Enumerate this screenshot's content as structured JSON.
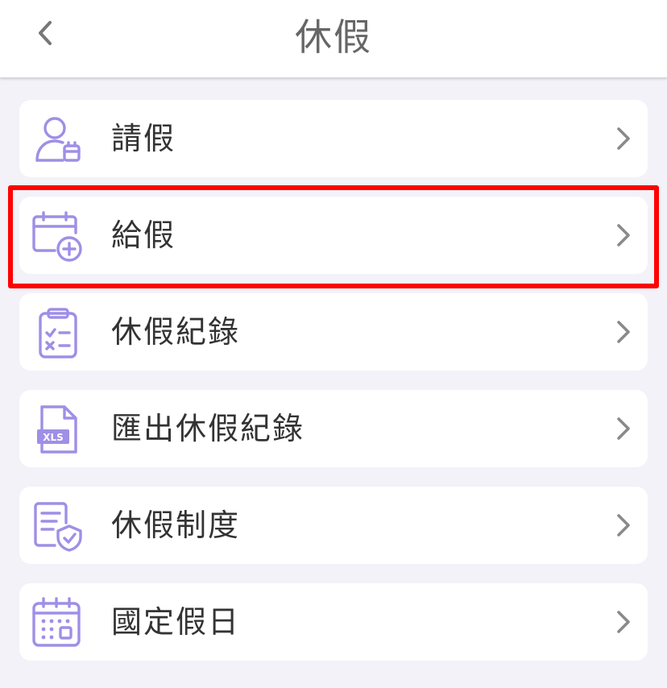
{
  "header": {
    "title": "休假",
    "back_icon": "chevron-left-icon"
  },
  "menu": [
    {
      "label": "請假",
      "icon": "person-calendar-icon"
    },
    {
      "label": "給假",
      "icon": "calendar-plus-icon",
      "highlighted": true
    },
    {
      "label": "休假紀錄",
      "icon": "clipboard-checklist-icon"
    },
    {
      "label": "匯出休假紀錄",
      "icon": "xls-file-icon",
      "icon_text": "XLS"
    },
    {
      "label": "休假制度",
      "icon": "document-shield-icon"
    },
    {
      "label": "國定假日",
      "icon": "calendar-grid-icon"
    }
  ],
  "colors": {
    "icon": "#9f8fe6",
    "chevron": "#8a8a8a",
    "highlight": "#ff0000",
    "background": "#f2f2f8"
  }
}
